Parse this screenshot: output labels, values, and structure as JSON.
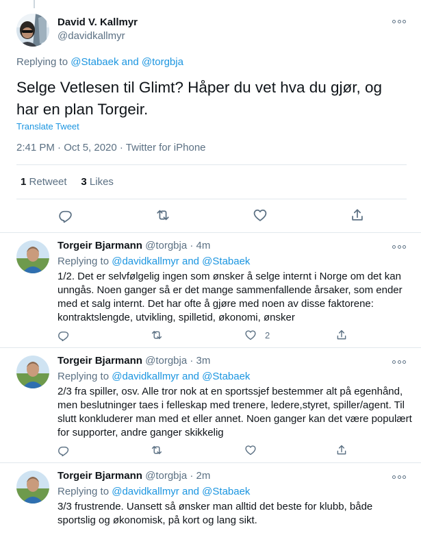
{
  "main_tweet": {
    "author_name": "David V. Kallmyr",
    "author_handle": "@davidkallmyr",
    "replying_label": "Replying to",
    "replying_to": "@Stabaek and @torgbja",
    "text": "Selge Vetlesen til Glimt? Håper du vet hva du gjør, og har en plan Torgeir.",
    "translate_label": "Translate Tweet",
    "timestamp": "2:41 PM · Oct 5, 2020 · Twitter for iPhone",
    "retweets_count": "1",
    "retweets_label": "Retweet",
    "likes_count": "3",
    "likes_label": "Likes",
    "actions": [
      "reply-icon",
      "retweet-icon",
      "like-icon",
      "share-icon"
    ]
  },
  "replies": [
    {
      "author_name": "Torgeir Bjarmann",
      "author_handle": "@torgbja",
      "time": "· 4m",
      "replying_label": "Replying to",
      "replying_to": "@davidkallmyr and @Stabaek",
      "text": "1/2. Det er selvfølgelig ingen som ønsker å selge internt i Norge om det kan unngås. Noen ganger så er det mange sammenfallende årsaker, som ender med et salg internt. Det har ofte å gjøre med noen av disse faktorene: kontraktslengde, utvikling, spilletid, økonomi, ønsker",
      "like_count": "2"
    },
    {
      "author_name": "Torgeir Bjarmann",
      "author_handle": "@torgbja",
      "time": "· 3m",
      "replying_label": "Replying to",
      "replying_to": "@davidkallmyr and @Stabaek",
      "text": "2/3 fra spiller, osv. Alle tror nok at en sportssjef bestemmer alt på egenhånd, men beslutninger taes i felleskap med trenere, ledere,styret, spiller/agent. Til slutt konkluderer man med et eller annet. Noen ganger kan det være populært for supporter, andre ganger skikkelig",
      "like_count": ""
    },
    {
      "author_name": "Torgeir Bjarmann",
      "author_handle": "@torgbja",
      "time": "· 2m",
      "replying_label": "Replying to",
      "replying_to": "@davidkallmyr and @Stabaek",
      "text": "3/3 frustrende. Uansett så ønsker man alltid det beste for klubb, både sportslig og økonomisk, på kort og lang sikt.",
      "like_count": ""
    }
  ],
  "colors": {
    "link_blue": "#1b95e0",
    "secondary_grey": "#5b7083",
    "divider": "#e1e8ed",
    "text": "#0f1419"
  }
}
